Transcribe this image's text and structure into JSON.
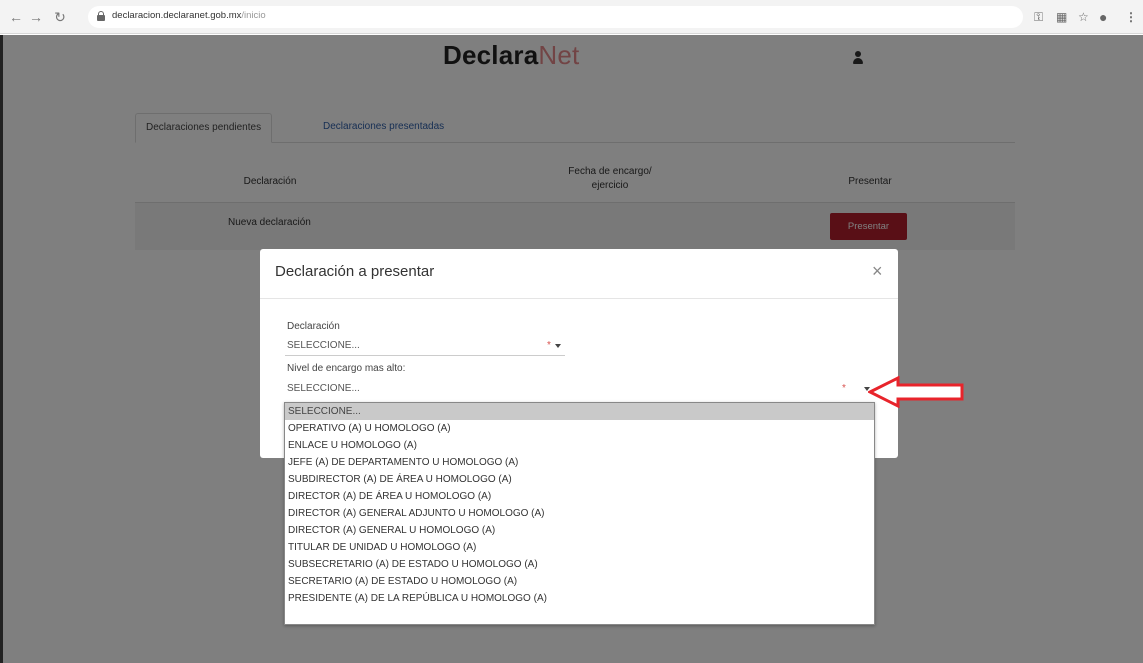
{
  "browser": {
    "url_domain": "declaracion.declaranet.gob.mx",
    "url_path": "/inicio"
  },
  "site": {
    "brand_main": "Declara",
    "brand_accent": "Net"
  },
  "tabs": {
    "pending": "Declaraciones pendientes",
    "presented": "Declaraciones presentadas"
  },
  "table": {
    "col_declaracion": "Declaración",
    "col_fecha": "Fecha de encargo/ ejercicio",
    "col_presentar": "Presentar",
    "row_label": "Nueva declaración",
    "row_button": "Presentar"
  },
  "modal": {
    "title": "Declaración a presentar",
    "close": "×",
    "field1_label": "Declaración",
    "field1_value": "SELECCIONE...",
    "field2_label": "Nivel de encargo mas alto:",
    "field2_value": "SELECCIONE...",
    "required_mark": "*"
  },
  "dropdown": {
    "options": [
      "SELECCIONE...",
      "OPERATIVO (A) U HOMOLOGO (A)",
      "ENLACE U HOMOLOGO (A)",
      "JEFE (A) DE DEPARTAMENTO U HOMOLOGO (A)",
      "SUBDIRECTOR (A) DE ÁREA U HOMOLOGO (A)",
      "DIRECTOR (A) DE ÁREA U HOMOLOGO (A)",
      "DIRECTOR (A) GENERAL ADJUNTO U HOMOLOGO (A)",
      "DIRECTOR (A) GENERAL U HOMOLOGO (A)",
      "TITULAR DE UNIDAD U HOMOLOGO (A)",
      "SUBSECRETARIO (A) DE ESTADO U HOMOLOGO (A)",
      "SECRETARIO (A) DE ESTADO U HOMOLOGO (A)",
      "PRESIDENTE (A) DE LA REPÚBLICA U HOMOLOGO (A)"
    ]
  },
  "colors": {
    "accent_red": "#b21f2d",
    "link_blue": "#2e5fa8",
    "arrow_red": "#e8242b"
  },
  "icons": {
    "back": "arrow-left-icon",
    "forward": "arrow-right-icon",
    "reload": "reload-icon",
    "lock": "lock-icon",
    "user": "user-icon",
    "close": "close-icon"
  }
}
